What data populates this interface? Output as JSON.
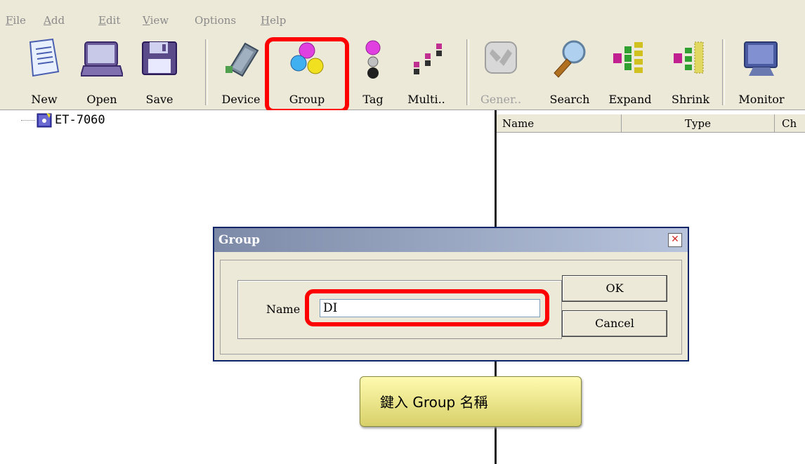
{
  "menu": {
    "items": [
      {
        "label": "File",
        "mnemonic": "F",
        "rest": "ile"
      },
      {
        "label": "Add",
        "mnemonic": "A",
        "rest": "dd"
      },
      {
        "label": "Edit",
        "mnemonic": "E",
        "rest": "dit"
      },
      {
        "label": "View",
        "mnemonic": "V",
        "rest": "iew"
      },
      {
        "label": "Options",
        "mnemonic": "",
        "rest": "Options"
      },
      {
        "label": "Help",
        "mnemonic": "H",
        "rest": "elp"
      }
    ]
  },
  "toolbar": {
    "buttons": [
      {
        "label": "New",
        "icon": "new-document-icon",
        "disabled": false
      },
      {
        "label": "Open",
        "icon": "open-folder-icon",
        "disabled": false
      },
      {
        "label": "Save",
        "icon": "floppy-disk-icon",
        "disabled": false
      },
      {
        "label": "Device",
        "icon": "device-module-icon",
        "disabled": false
      },
      {
        "label": "Group",
        "icon": "group-dots-icon",
        "disabled": false
      },
      {
        "label": "Tag",
        "icon": "tag-dots-icon",
        "disabled": false
      },
      {
        "label": "Multi..",
        "icon": "multi-tag-icon",
        "disabled": false
      },
      {
        "label": "Gener..",
        "icon": "general-tools-icon",
        "disabled": true
      },
      {
        "label": "Search",
        "icon": "magnifier-icon",
        "disabled": false
      },
      {
        "label": "Expand",
        "icon": "expand-tree-icon",
        "disabled": false
      },
      {
        "label": "Shrink",
        "icon": "shrink-tree-icon",
        "disabled": false
      },
      {
        "label": "Monitor",
        "icon": "monitor-icon",
        "disabled": false
      }
    ]
  },
  "tree": {
    "root_label": "ET-7060",
    "root_icon": "device-node-icon"
  },
  "list": {
    "columns": [
      "Name",
      "Type",
      "Ch"
    ]
  },
  "dialog": {
    "title": "Group",
    "name_label": "Name",
    "name_value": "DI",
    "ok_label": "OK",
    "cancel_label": "Cancel"
  },
  "callout": {
    "text": "鍵入 Group 名稱"
  },
  "colors": {
    "highlight": "#ff0000",
    "window_bg": "#ece9d8",
    "dialog_title": "#7c8aa8"
  }
}
